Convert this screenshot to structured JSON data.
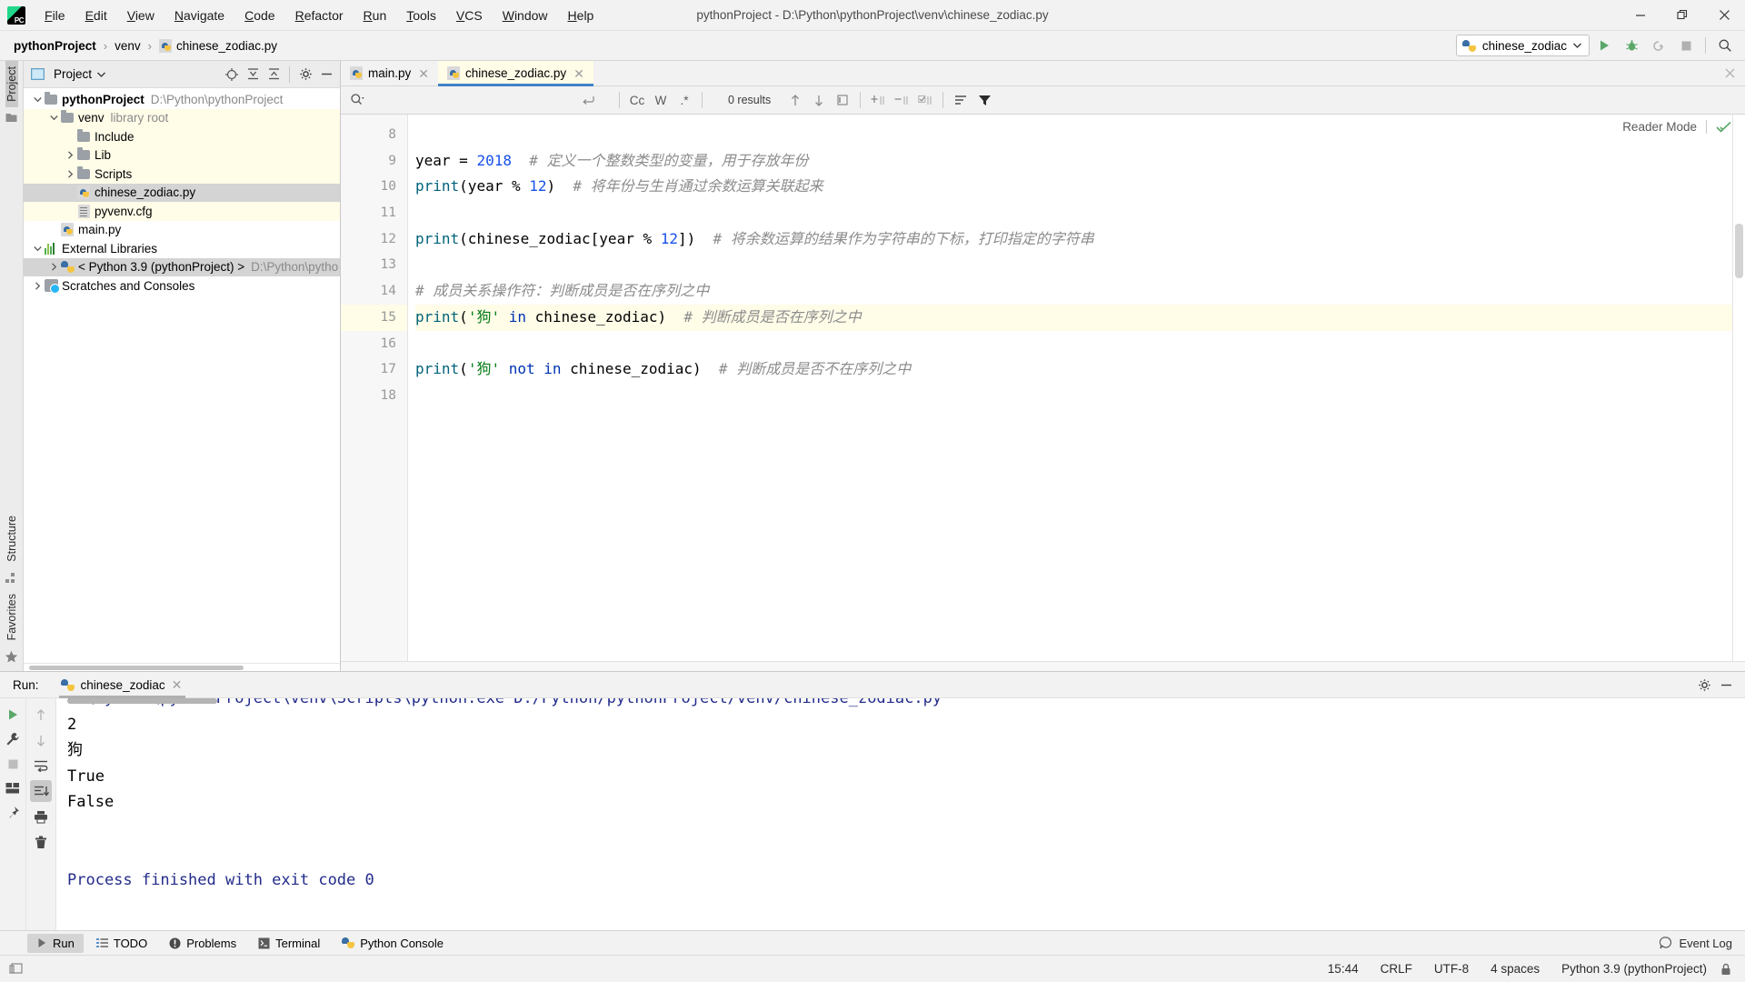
{
  "window": {
    "title": "pythonProject - D:\\Python\\pythonProject\\venv\\chinese_zodiac.py",
    "app_logo": "pycharm-logo-icon",
    "minimize": "minimize-icon",
    "maximize": "maximize-icon",
    "close": "close-icon"
  },
  "menubar": {
    "items": [
      {
        "label": "File"
      },
      {
        "label": "Edit"
      },
      {
        "label": "View"
      },
      {
        "label": "Navigate"
      },
      {
        "label": "Code"
      },
      {
        "label": "Refactor"
      },
      {
        "label": "Run"
      },
      {
        "label": "Tools"
      },
      {
        "label": "VCS"
      },
      {
        "label": "Window"
      },
      {
        "label": "Help"
      }
    ]
  },
  "breadcrumb": {
    "items": [
      {
        "label": "pythonProject",
        "bold": true
      },
      {
        "label": "venv",
        "bold": false
      },
      {
        "label": "chinese_zodiac.py",
        "bold": false,
        "icon": "python-file-icon"
      }
    ],
    "separator": "›"
  },
  "toolbar": {
    "run_config": {
      "label": "chinese_zodiac",
      "icon": "python-icon",
      "chevron": "chevron-down-icon"
    },
    "buttons": [
      {
        "name": "run-button",
        "icon": "play-icon"
      },
      {
        "name": "debug-button",
        "icon": "bug-icon"
      },
      {
        "name": "run-with-coverage-button",
        "icon": "coverage-icon"
      },
      {
        "name": "stop-button",
        "icon": "stop-icon"
      },
      {
        "name": "search-everywhere-button",
        "icon": "search-icon"
      }
    ]
  },
  "left_strip": {
    "top_label": "Project",
    "bottom_labels": [
      "Structure",
      "Favorites"
    ],
    "bookmark_icon": "bookmark-icon",
    "structure_icon": "structure-icon",
    "favorites_icon": "star-icon"
  },
  "project_panel": {
    "title": "Project",
    "title_chevron": "chevron-down-icon",
    "tools": [
      {
        "name": "select-opened-file-button",
        "icon": "target-icon"
      },
      {
        "name": "expand-all-button",
        "icon": "expand-all-icon"
      },
      {
        "name": "collapse-all-button",
        "icon": "collapse-all-icon"
      },
      {
        "name": "settings-button",
        "icon": "gear-icon"
      },
      {
        "name": "hide-button",
        "icon": "minus-icon"
      }
    ],
    "tree": [
      {
        "label": "pythonProject",
        "sub": "D:\\Python\\pythonProject",
        "indent": 0,
        "arrow": "expanded",
        "icon": "folder-icon",
        "bold": true,
        "state": "normal"
      },
      {
        "label": "venv",
        "sub": "library root",
        "indent": 1,
        "arrow": "expanded",
        "icon": "folder-icon",
        "bold": false,
        "state": "yellow"
      },
      {
        "label": "Include",
        "sub": "",
        "indent": 2,
        "arrow": "none",
        "icon": "folder-icon",
        "bold": false,
        "state": "yellow"
      },
      {
        "label": "Lib",
        "sub": "",
        "indent": 2,
        "arrow": "collapsed",
        "icon": "folder-icon",
        "bold": false,
        "state": "yellow"
      },
      {
        "label": "Scripts",
        "sub": "",
        "indent": 2,
        "arrow": "collapsed",
        "icon": "folder-icon",
        "bold": false,
        "state": "yellow"
      },
      {
        "label": "chinese_zodiac.py",
        "sub": "",
        "indent": 2,
        "arrow": "none",
        "icon": "python-file-icon",
        "bold": false,
        "state": "selected"
      },
      {
        "label": "pyvenv.cfg",
        "sub": "",
        "indent": 2,
        "arrow": "none",
        "icon": "cfg-file-icon",
        "bold": false,
        "state": "yellow"
      },
      {
        "label": "main.py",
        "sub": "",
        "indent": 1,
        "arrow": "none",
        "icon": "python-file-icon",
        "bold": false,
        "state": "normal"
      },
      {
        "label": "External Libraries",
        "sub": "",
        "indent": 0,
        "arrow": "expanded",
        "icon": "library-icon",
        "bold": false,
        "state": "normal"
      },
      {
        "label": "< Python 3.9 (pythonProject) >",
        "sub": "D:\\Python\\pytho",
        "indent": 1,
        "arrow": "collapsed",
        "icon": "python-icon",
        "bold": false,
        "state": "selected-light"
      },
      {
        "label": "Scratches and Consoles",
        "sub": "",
        "indent": 0,
        "arrow": "collapsed",
        "icon": "scratches-icon",
        "bold": false,
        "state": "normal"
      }
    ]
  },
  "editor": {
    "tabs": [
      {
        "label": "main.py",
        "icon": "python-file-icon",
        "active": false,
        "close": "close-icon"
      },
      {
        "label": "chinese_zodiac.py",
        "icon": "python-file-icon",
        "active": true,
        "close": "close-icon"
      }
    ],
    "findbar": {
      "search_icon": "search-dropdown-icon",
      "value": "",
      "placeholder": "",
      "history_icon": "return-icon",
      "toggles": [
        {
          "name": "match-case-toggle",
          "label": "Cc"
        },
        {
          "name": "words-toggle",
          "label": "W"
        },
        {
          "name": "regex-toggle",
          "label": ".*"
        }
      ],
      "results": "0 results",
      "nav": [
        {
          "name": "find-previous-button",
          "icon": "arrow-up-icon"
        },
        {
          "name": "find-next-button",
          "icon": "arrow-down-icon"
        },
        {
          "name": "select-all-occurrences-button",
          "icon": "select-all-icon"
        }
      ],
      "scope": [
        {
          "name": "add-line-before-button",
          "icon": "add-line-icon"
        },
        {
          "name": "remove-line-button",
          "icon": "remove-line-icon"
        },
        {
          "name": "check-lines-button",
          "icon": "check-lines-icon"
        }
      ],
      "extras": [
        {
          "name": "filter-options-button",
          "icon": "options-icon"
        },
        {
          "name": "filter-button",
          "icon": "filter-icon"
        }
      ]
    },
    "reader_mode": {
      "label": "Reader Mode",
      "check_icon": "checkmark-icon",
      "close_icon": "close-icon"
    },
    "first_line_number": 8,
    "lines": [
      {
        "n": 8,
        "highlight": false,
        "tokens": []
      },
      {
        "n": 9,
        "highlight": false,
        "tokens": [
          {
            "t": "year ",
            "c": "op"
          },
          {
            "t": "= ",
            "c": "op"
          },
          {
            "t": "2018",
            "c": "num"
          },
          {
            "t": "  ",
            "c": "op"
          },
          {
            "t": "# 定义一个整数类型的变量，用于存放年份",
            "c": "cmt"
          }
        ]
      },
      {
        "n": 10,
        "highlight": false,
        "tokens": [
          {
            "t": "print",
            "c": "fn"
          },
          {
            "t": "(year % ",
            "c": "op"
          },
          {
            "t": "12",
            "c": "num"
          },
          {
            "t": ")",
            "c": "op"
          },
          {
            "t": "  ",
            "c": "op"
          },
          {
            "t": "# 将年份与生肖通过余数运算关联起来",
            "c": "cmt"
          }
        ]
      },
      {
        "n": 11,
        "highlight": false,
        "tokens": []
      },
      {
        "n": 12,
        "highlight": false,
        "tokens": [
          {
            "t": "print",
            "c": "fn"
          },
          {
            "t": "(chinese_zodiac[year % ",
            "c": "op"
          },
          {
            "t": "12",
            "c": "num"
          },
          {
            "t": "])",
            "c": "op"
          },
          {
            "t": "  ",
            "c": "op"
          },
          {
            "t": "# 将余数运算的结果作为字符串的下标，打印指定的字符串",
            "c": "cmt"
          }
        ]
      },
      {
        "n": 13,
        "highlight": false,
        "tokens": []
      },
      {
        "n": 14,
        "highlight": false,
        "tokens": [
          {
            "t": "# 成员关系操作符：判断成员是否在序列之中",
            "c": "cmt"
          }
        ]
      },
      {
        "n": 15,
        "highlight": true,
        "tokens": [
          {
            "t": "print",
            "c": "fn"
          },
          {
            "t": "(",
            "c": "op"
          },
          {
            "t": "'狗'",
            "c": "str"
          },
          {
            "t": " ",
            "c": "op"
          },
          {
            "t": "in",
            "c": "kw"
          },
          {
            "t": " chinese_zodiac)",
            "c": "op"
          },
          {
            "t": "  ",
            "c": "op"
          },
          {
            "t": "# 判断成员是否在序列之中",
            "c": "cmt"
          }
        ]
      },
      {
        "n": 16,
        "highlight": false,
        "tokens": []
      },
      {
        "n": 17,
        "highlight": false,
        "tokens": [
          {
            "t": "print",
            "c": "fn"
          },
          {
            "t": "(",
            "c": "op"
          },
          {
            "t": "'狗'",
            "c": "str"
          },
          {
            "t": " ",
            "c": "op"
          },
          {
            "t": "not in",
            "c": "kw"
          },
          {
            "t": " chinese_zodiac)",
            "c": "op"
          },
          {
            "t": "  ",
            "c": "op"
          },
          {
            "t": "# 判断成员是否不在序列之中",
            "c": "cmt"
          }
        ]
      },
      {
        "n": 18,
        "highlight": false,
        "tokens": []
      }
    ]
  },
  "run_panel": {
    "run_label": "Run:",
    "tab": {
      "label": "chinese_zodiac",
      "icon": "python-icon",
      "close": "close-icon"
    },
    "header_buttons": [
      {
        "name": "run-settings-button",
        "icon": "gear-icon"
      },
      {
        "name": "hide-run-panel-button",
        "icon": "minus-icon"
      }
    ],
    "left_tools": [
      {
        "name": "rerun-button",
        "icon": "play-icon"
      },
      {
        "name": "run-configuration-button",
        "icon": "wrench-icon"
      },
      {
        "name": "stop-process-button",
        "icon": "stop-icon"
      },
      {
        "name": "restore-layout-button",
        "icon": "layout-icon"
      },
      {
        "name": "pin-tab-button",
        "icon": "pin-icon"
      }
    ],
    "second_tools": [
      {
        "name": "up-stacktrace-button",
        "icon": "arrow-up-icon"
      },
      {
        "name": "down-stacktrace-button",
        "icon": "arrow-down-icon"
      },
      {
        "name": "soft-wrap-button",
        "icon": "wrap-icon"
      },
      {
        "name": "scroll-to-end-button",
        "icon": "scroll-end-icon",
        "active": true
      },
      {
        "name": "print-button",
        "icon": "printer-icon"
      },
      {
        "name": "clear-all-button",
        "icon": "trash-icon"
      }
    ],
    "console": [
      {
        "text": "D:\\Python\\pythonProject\\venv\\Scripts\\python.exe D:/Python/pythonProject/venv/chinese_zodiac.py",
        "style": "blue"
      },
      {
        "text": "2",
        "style": "plain"
      },
      {
        "text": "狗",
        "style": "plain"
      },
      {
        "text": "True",
        "style": "plain"
      },
      {
        "text": "False",
        "style": "plain"
      },
      {
        "text": "",
        "style": "plain"
      },
      {
        "text": "",
        "style": "plain"
      },
      {
        "text": "Process finished with exit code 0",
        "style": "blue"
      }
    ]
  },
  "bottom_bar": {
    "items": [
      {
        "label": "Run",
        "icon": "play-icon",
        "active": true
      },
      {
        "label": "TODO",
        "icon": "todo-icon",
        "active": false
      },
      {
        "label": "Problems",
        "icon": "problems-icon",
        "active": false
      },
      {
        "label": "Terminal",
        "icon": "terminal-icon",
        "active": false
      },
      {
        "label": "Python Console",
        "icon": "python-icon",
        "active": false
      }
    ],
    "event_log": {
      "label": "Event Log",
      "icon": "event-log-icon"
    }
  },
  "status_bar": {
    "left_icon": "show-layout-icon",
    "items": [
      "15:44",
      "CRLF",
      "UTF-8",
      "4 spaces",
      "Python 3.9 (pythonProject)"
    ],
    "lock_icon": "lock-icon"
  }
}
